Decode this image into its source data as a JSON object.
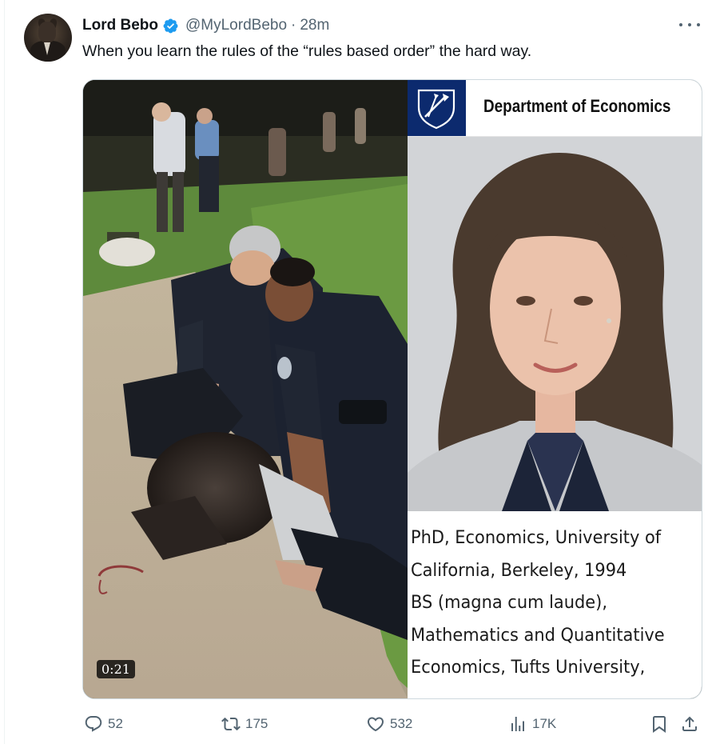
{
  "tweet": {
    "author_name": "Lord Bebo",
    "handle": "@MyLordBebo",
    "separator": "·",
    "time": "28m",
    "text": "When you learn the rules of the “rules based order” the hard way."
  },
  "media": {
    "video_duration": "0:21",
    "right_panel": {
      "department_title": "Department of Economics",
      "credentials": [
        "PhD, Economics, University of",
        "California, Berkeley, 1994",
        "BS (magna cum laude),",
        "Mathematics and Quantitative",
        "Economics, Tufts University,"
      ]
    }
  },
  "actions": {
    "replies": "52",
    "reposts": "175",
    "likes": "532",
    "views": "17K"
  },
  "icons": {
    "verified": "verified-badge-icon",
    "more": "more-icon",
    "reply": "reply-icon",
    "repost": "repost-icon",
    "like": "heart-icon",
    "views": "views-icon",
    "bookmark": "bookmark-icon",
    "share": "share-icon"
  },
  "colors": {
    "text_primary": "#0f1419",
    "text_secondary": "#536471",
    "verified_blue": "#1d9bf0",
    "emory_navy": "#0c2a6e"
  }
}
